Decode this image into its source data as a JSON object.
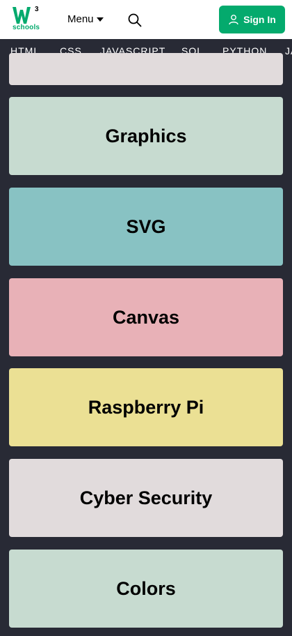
{
  "header": {
    "logo_text": "schools",
    "logo_superscript": "3",
    "menu_label": "Menu",
    "signin_label": "Sign In",
    "brand_color": "#04AA6D"
  },
  "nav": {
    "items": [
      "HTML",
      "CSS",
      "JAVASCRIPT",
      "SQL",
      "PYTHON",
      "JA"
    ]
  },
  "cards": [
    {
      "label": "",
      "color": "#E1DBDC"
    },
    {
      "label": "Graphics",
      "color": "#C7DBD0"
    },
    {
      "label": "SVG",
      "color": "#88C2C3"
    },
    {
      "label": "Canvas",
      "color": "#E8B1B7"
    },
    {
      "label": "Raspberry Pi",
      "color": "#EBE094"
    },
    {
      "label": "Cyber Security",
      "color": "#E1DBDC"
    },
    {
      "label": "Colors",
      "color": "#C7DBD0"
    }
  ]
}
